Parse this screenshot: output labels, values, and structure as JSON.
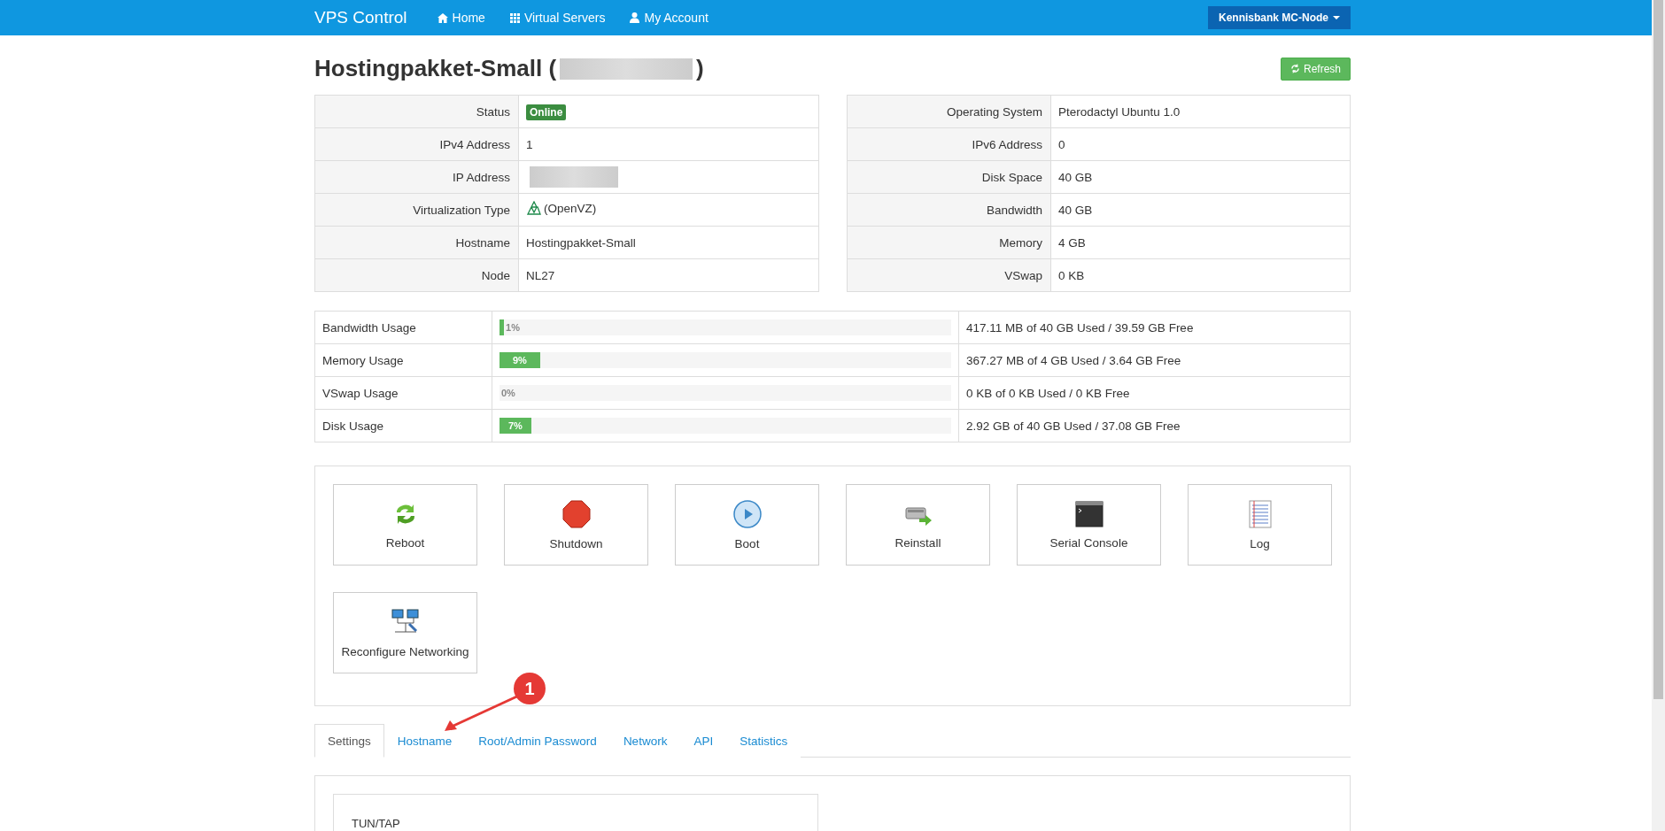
{
  "navbar": {
    "brand": "VPS Control",
    "links": [
      {
        "label": "Home"
      },
      {
        "label": "Virtual Servers"
      },
      {
        "label": "My Account"
      }
    ],
    "node_menu": "Kennisbank MC-Node"
  },
  "header": {
    "title": "Hostingpakket-Small (",
    "title_end": ")",
    "refresh": "Refresh"
  },
  "info_left": [
    {
      "label": "Status",
      "kind": "badge",
      "value": "Online"
    },
    {
      "label": "IPv4 Address",
      "kind": "text",
      "value": "1"
    },
    {
      "label": "IP Address",
      "kind": "redacted"
    },
    {
      "label": "Virtualization Type",
      "kind": "virt",
      "value": "(OpenVZ)"
    },
    {
      "label": "Hostname",
      "kind": "text",
      "value": "Hostingpakket-Small"
    },
    {
      "label": "Node",
      "kind": "text",
      "value": "NL27"
    }
  ],
  "info_right": [
    {
      "label": "Operating System",
      "value": "Pterodactyl Ubuntu 1.0"
    },
    {
      "label": "IPv6 Address",
      "value": "0"
    },
    {
      "label": "Disk Space",
      "value": "40 GB"
    },
    {
      "label": "Bandwidth",
      "value": "40 GB"
    },
    {
      "label": "Memory",
      "value": "4 GB"
    },
    {
      "label": "VSwap",
      "value": "0 KB"
    }
  ],
  "usage": [
    {
      "label": "Bandwidth Usage",
      "percent": "1%",
      "level": 0.01,
      "detail": "417.11 MB of 40 GB Used / 39.59 GB Free"
    },
    {
      "label": "Memory Usage",
      "percent": "9%",
      "level": 0.09,
      "detail": "367.27 MB of 4 GB Used / 3.64 GB Free"
    },
    {
      "label": "VSwap Usage",
      "percent": "0%",
      "level": 0,
      "detail": "0 KB of 0 KB Used / 0 KB Free"
    },
    {
      "label": "Disk Usage",
      "percent": "7%",
      "level": 0.07,
      "detail": "2.92 GB of 40 GB Used / 37.08 GB Free"
    }
  ],
  "actions": [
    {
      "label": "Reboot"
    },
    {
      "label": "Shutdown"
    },
    {
      "label": "Boot"
    },
    {
      "label": "Reinstall"
    },
    {
      "label": "Serial Console"
    },
    {
      "label": "Log"
    },
    {
      "label": "Reconfigure Networking"
    }
  ],
  "tabs": [
    {
      "label": "Settings",
      "selected": true
    },
    {
      "label": "Hostname",
      "selected": false
    },
    {
      "label": "Root/Admin Password",
      "selected": false
    },
    {
      "label": "Network",
      "selected": false
    },
    {
      "label": "API",
      "selected": false
    },
    {
      "label": "Statistics",
      "selected": false
    }
  ],
  "settings": {
    "first_item": "TUN/TAP"
  },
  "annotation": {
    "marker": "1"
  }
}
